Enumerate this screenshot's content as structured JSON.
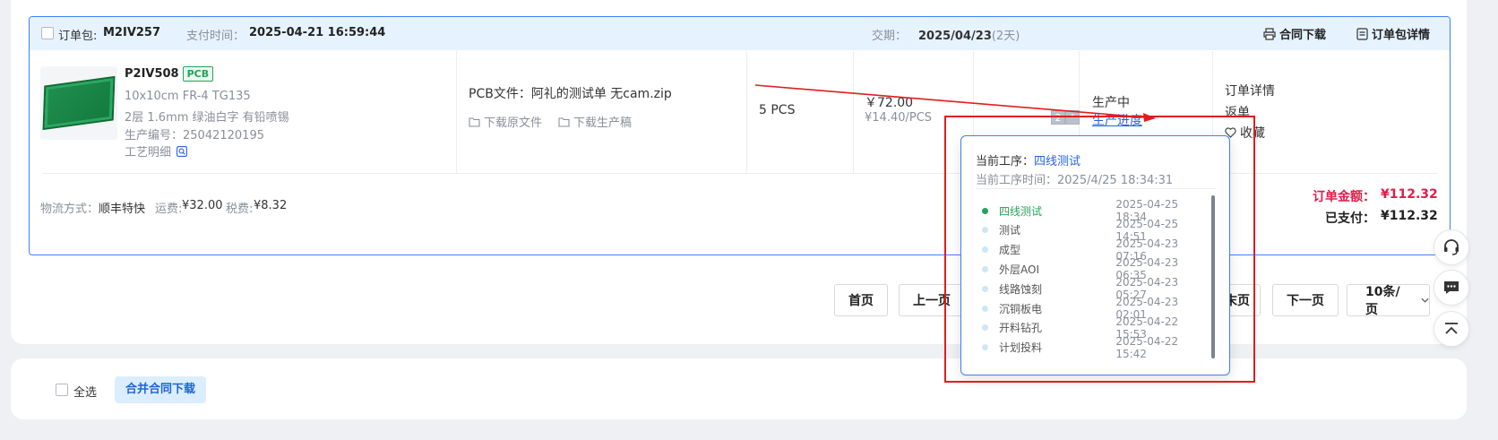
{
  "order": {
    "package_label": "订单包:",
    "package_id": "M2IV257",
    "pay_time_label": "支付时间：",
    "pay_time": "2025-04-21 16:59:44",
    "delivery_label": "交期：",
    "delivery_date": "2025/04/23",
    "delivery_days": "(2天)",
    "contract_download": "合同下载",
    "package_details": "订单包详情",
    "item": {
      "id": "P2IV508",
      "tag": "PCB",
      "spec1": "10x10cm FR-4 TG135",
      "spec2": "2层 1.6mm 绿油白字 有铅喷锡",
      "prod_no_label": "生产编号：",
      "prod_no": "25042120195",
      "craft_label": "工艺明细",
      "file_label": "PCB文件：",
      "file_name": "阿礼的测试单 无cam.zip",
      "download_source": "下载原文件",
      "download_production": "下载生产稿",
      "quantity": "5 PCS",
      "price": "￥72.00",
      "unit_price": "¥14.40/PCS",
      "number_badge": "2",
      "status": "生产中",
      "progress_link": "生产进度",
      "action_details": "订单详情",
      "action_return": "返单",
      "action_favorite": "收藏"
    },
    "footer": {
      "logistics_label": "物流方式：",
      "logistics": "顺丰特快",
      "shipping_label": "运费:",
      "shipping": "¥32.00",
      "tax_label": "税费:",
      "tax": "¥8.32",
      "total_label": "订单金额：",
      "total": "¥112.32",
      "paid_label": "已支付：",
      "paid": "¥112.32"
    }
  },
  "pager": {
    "first": "首页",
    "prev": "上一页",
    "last_partial": "末页",
    "next": "下一页",
    "page_size": "10条/页"
  },
  "bottom": {
    "select_all": "全选",
    "merge_download": "合并合同下载"
  },
  "popup": {
    "current_label": "当前工序：",
    "current_step": "四线测试",
    "current_time_label": "当前工序时间：",
    "current_time": "2025/4/25 18:34:31",
    "steps": [
      {
        "name": "四线测试",
        "time": "2025-04-25 18:34"
      },
      {
        "name": "测试",
        "time": "2025-04-25 14:51"
      },
      {
        "name": "成型",
        "time": "2025-04-23 07:16"
      },
      {
        "name": "外层AOI",
        "time": "2025-04-23 06:35"
      },
      {
        "name": "线路蚀刻",
        "time": "2025-04-23 05:27"
      },
      {
        "name": "沉铜板电",
        "time": "2025-04-23 02:01"
      },
      {
        "name": "开料钻孔",
        "time": "2025-04-22 15:53"
      },
      {
        "name": "计划投料",
        "time": "2025-04-22 15:42"
      }
    ]
  },
  "colors": {
    "accent_blue": "#2563eb",
    "header_bg": "#e6f3ff",
    "success_green": "#23a45b",
    "price_red": "#e11d48",
    "annotation_red": "#e11d1d"
  },
  "icons": [
    "printer-icon",
    "document-icon",
    "search-icon",
    "folder-icon",
    "heart-icon",
    "headset-icon",
    "chat-icon",
    "to-top-icon",
    "chevron-down-icon"
  ]
}
